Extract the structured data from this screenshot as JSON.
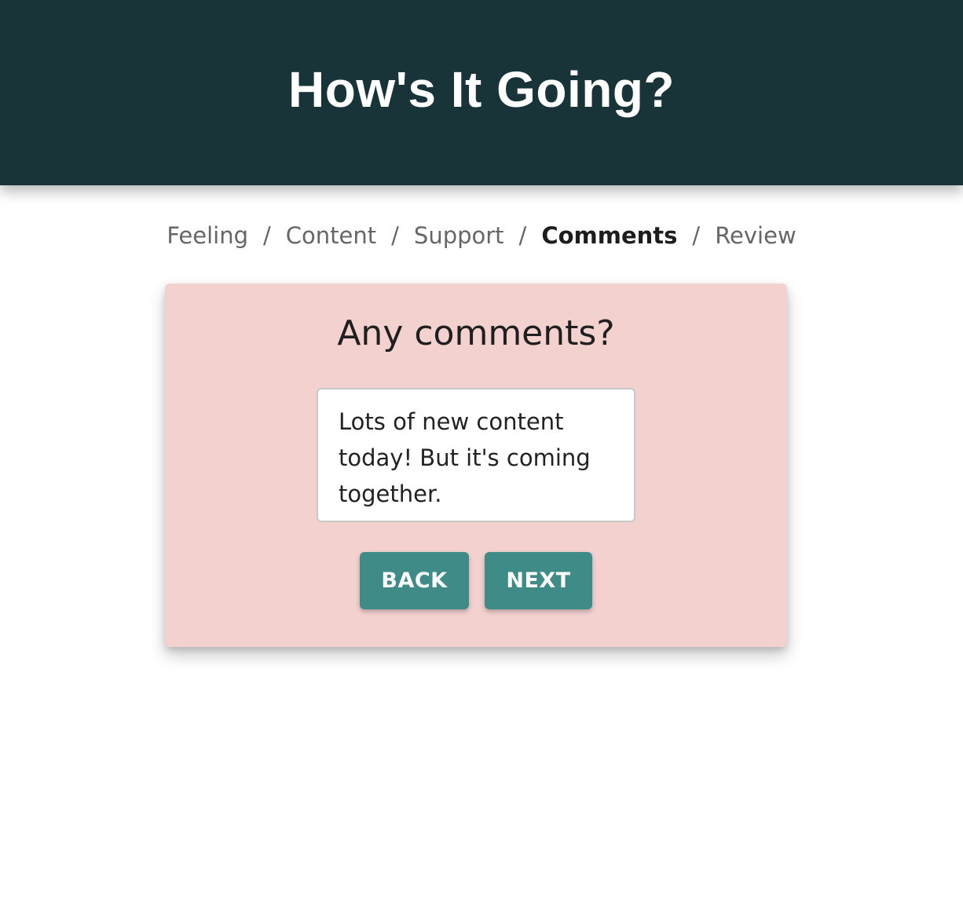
{
  "header": {
    "title": "How's It Going?"
  },
  "breadcrumb": {
    "items": [
      {
        "label": "Feeling",
        "active": false
      },
      {
        "label": "Content",
        "active": false
      },
      {
        "label": "Support",
        "active": false
      },
      {
        "label": "Comments",
        "active": true
      },
      {
        "label": "Review",
        "active": false
      }
    ],
    "separator": "/"
  },
  "card": {
    "title": "Any comments?",
    "comment_value": "Lots of new content today! But it's coming together.",
    "back_label": "BACK",
    "next_label": "NEXT"
  },
  "colors": {
    "header_bg": "#183438",
    "card_bg": "#f2d1cf",
    "button_bg": "#3f8b87"
  }
}
